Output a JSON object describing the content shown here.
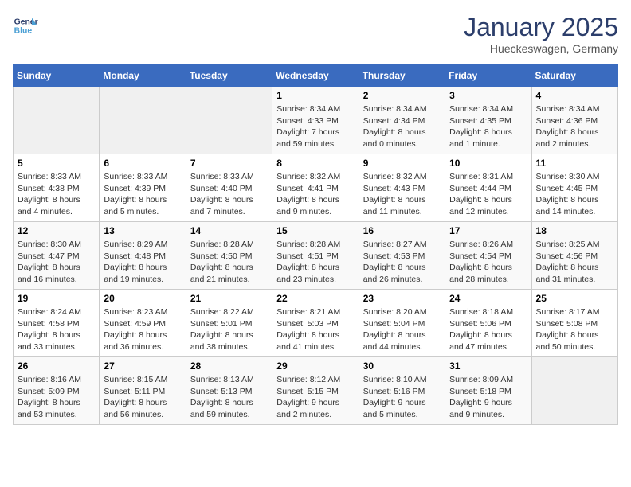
{
  "logo": {
    "line1": "General",
    "line2": "Blue"
  },
  "title": "January 2025",
  "subtitle": "Hueckeswagen, Germany",
  "weekdays": [
    "Sunday",
    "Monday",
    "Tuesday",
    "Wednesday",
    "Thursday",
    "Friday",
    "Saturday"
  ],
  "weeks": [
    [
      {
        "day": "",
        "info": ""
      },
      {
        "day": "",
        "info": ""
      },
      {
        "day": "",
        "info": ""
      },
      {
        "day": "1",
        "info": "Sunrise: 8:34 AM\nSunset: 4:33 PM\nDaylight: 7 hours and 59 minutes."
      },
      {
        "day": "2",
        "info": "Sunrise: 8:34 AM\nSunset: 4:34 PM\nDaylight: 8 hours and 0 minutes."
      },
      {
        "day": "3",
        "info": "Sunrise: 8:34 AM\nSunset: 4:35 PM\nDaylight: 8 hours and 1 minute."
      },
      {
        "day": "4",
        "info": "Sunrise: 8:34 AM\nSunset: 4:36 PM\nDaylight: 8 hours and 2 minutes."
      }
    ],
    [
      {
        "day": "5",
        "info": "Sunrise: 8:33 AM\nSunset: 4:38 PM\nDaylight: 8 hours and 4 minutes."
      },
      {
        "day": "6",
        "info": "Sunrise: 8:33 AM\nSunset: 4:39 PM\nDaylight: 8 hours and 5 minutes."
      },
      {
        "day": "7",
        "info": "Sunrise: 8:33 AM\nSunset: 4:40 PM\nDaylight: 8 hours and 7 minutes."
      },
      {
        "day": "8",
        "info": "Sunrise: 8:32 AM\nSunset: 4:41 PM\nDaylight: 8 hours and 9 minutes."
      },
      {
        "day": "9",
        "info": "Sunrise: 8:32 AM\nSunset: 4:43 PM\nDaylight: 8 hours and 11 minutes."
      },
      {
        "day": "10",
        "info": "Sunrise: 8:31 AM\nSunset: 4:44 PM\nDaylight: 8 hours and 12 minutes."
      },
      {
        "day": "11",
        "info": "Sunrise: 8:30 AM\nSunset: 4:45 PM\nDaylight: 8 hours and 14 minutes."
      }
    ],
    [
      {
        "day": "12",
        "info": "Sunrise: 8:30 AM\nSunset: 4:47 PM\nDaylight: 8 hours and 16 minutes."
      },
      {
        "day": "13",
        "info": "Sunrise: 8:29 AM\nSunset: 4:48 PM\nDaylight: 8 hours and 19 minutes."
      },
      {
        "day": "14",
        "info": "Sunrise: 8:28 AM\nSunset: 4:50 PM\nDaylight: 8 hours and 21 minutes."
      },
      {
        "day": "15",
        "info": "Sunrise: 8:28 AM\nSunset: 4:51 PM\nDaylight: 8 hours and 23 minutes."
      },
      {
        "day": "16",
        "info": "Sunrise: 8:27 AM\nSunset: 4:53 PM\nDaylight: 8 hours and 26 minutes."
      },
      {
        "day": "17",
        "info": "Sunrise: 8:26 AM\nSunset: 4:54 PM\nDaylight: 8 hours and 28 minutes."
      },
      {
        "day": "18",
        "info": "Sunrise: 8:25 AM\nSunset: 4:56 PM\nDaylight: 8 hours and 31 minutes."
      }
    ],
    [
      {
        "day": "19",
        "info": "Sunrise: 8:24 AM\nSunset: 4:58 PM\nDaylight: 8 hours and 33 minutes."
      },
      {
        "day": "20",
        "info": "Sunrise: 8:23 AM\nSunset: 4:59 PM\nDaylight: 8 hours and 36 minutes."
      },
      {
        "day": "21",
        "info": "Sunrise: 8:22 AM\nSunset: 5:01 PM\nDaylight: 8 hours and 38 minutes."
      },
      {
        "day": "22",
        "info": "Sunrise: 8:21 AM\nSunset: 5:03 PM\nDaylight: 8 hours and 41 minutes."
      },
      {
        "day": "23",
        "info": "Sunrise: 8:20 AM\nSunset: 5:04 PM\nDaylight: 8 hours and 44 minutes."
      },
      {
        "day": "24",
        "info": "Sunrise: 8:18 AM\nSunset: 5:06 PM\nDaylight: 8 hours and 47 minutes."
      },
      {
        "day": "25",
        "info": "Sunrise: 8:17 AM\nSunset: 5:08 PM\nDaylight: 8 hours and 50 minutes."
      }
    ],
    [
      {
        "day": "26",
        "info": "Sunrise: 8:16 AM\nSunset: 5:09 PM\nDaylight: 8 hours and 53 minutes."
      },
      {
        "day": "27",
        "info": "Sunrise: 8:15 AM\nSunset: 5:11 PM\nDaylight: 8 hours and 56 minutes."
      },
      {
        "day": "28",
        "info": "Sunrise: 8:13 AM\nSunset: 5:13 PM\nDaylight: 8 hours and 59 minutes."
      },
      {
        "day": "29",
        "info": "Sunrise: 8:12 AM\nSunset: 5:15 PM\nDaylight: 9 hours and 2 minutes."
      },
      {
        "day": "30",
        "info": "Sunrise: 8:10 AM\nSunset: 5:16 PM\nDaylight: 9 hours and 5 minutes."
      },
      {
        "day": "31",
        "info": "Sunrise: 8:09 AM\nSunset: 5:18 PM\nDaylight: 9 hours and 9 minutes."
      },
      {
        "day": "",
        "info": ""
      }
    ]
  ]
}
